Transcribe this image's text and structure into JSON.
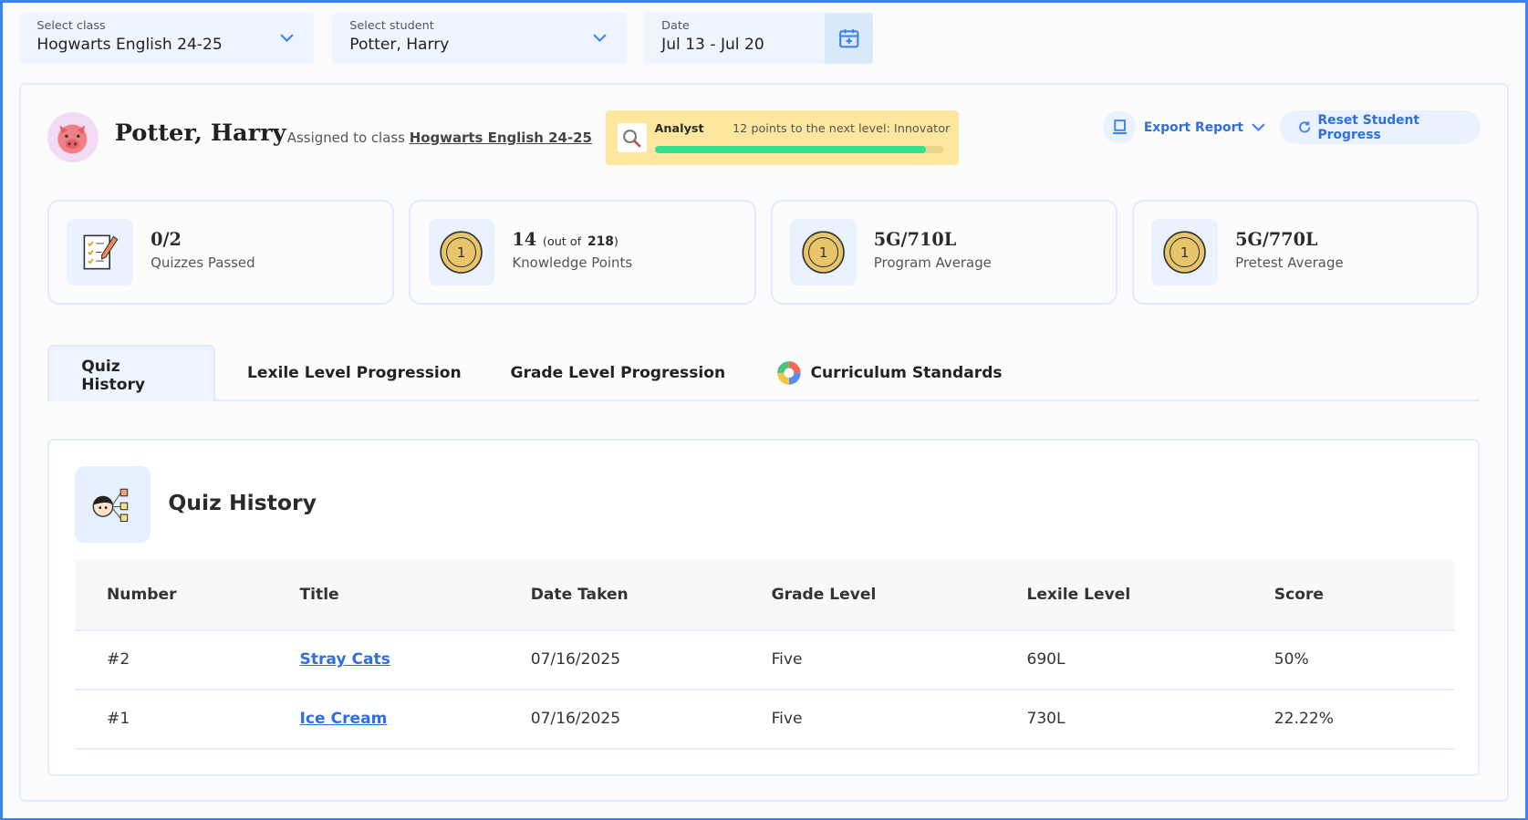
{
  "filters": {
    "class": {
      "label": "Select class",
      "value": "Hogwarts English 24-25"
    },
    "student": {
      "label": "Select student",
      "value": "Potter, Harry"
    },
    "date": {
      "label": "Date",
      "value": "Jul 13 - Jul 20"
    }
  },
  "student": {
    "name": "Potter, Harry",
    "assigned_prefix": "Assigned to class",
    "class_link": "Hogwarts English 24-25"
  },
  "level": {
    "current": "Analyst",
    "next_text": "12 points to the next level: Innovator",
    "progress_percent": 94
  },
  "actions": {
    "export": "Export Report",
    "reset": "Reset Student Progress"
  },
  "stats": [
    {
      "value": "0/2",
      "label": "Quizzes Passed",
      "icon": "quiz-checklist-icon"
    },
    {
      "value": "14",
      "extra_prefix": "(out of",
      "extra_value": "218",
      "extra_suffix": ")",
      "label": "Knowledge Points",
      "icon": "coin-icon"
    },
    {
      "value": "5G/710L",
      "label": "Program Average",
      "icon": "coin-icon"
    },
    {
      "value": "5G/770L",
      "label": "Pretest Average",
      "icon": "coin-icon"
    }
  ],
  "tabs": [
    {
      "label": "Quiz History"
    },
    {
      "label": "Lexile Level Progression"
    },
    {
      "label": "Grade Level Progression"
    },
    {
      "label": "Curriculum Standards"
    }
  ],
  "quiz_history": {
    "title": "Quiz History",
    "columns": [
      "Number",
      "Title",
      "Date Taken",
      "Grade Level",
      "Lexile Level",
      "Score"
    ],
    "rows": [
      [
        "#2",
        "Stray Cats",
        "07/16/2025",
        "Five",
        "690L",
        "50%"
      ],
      [
        "#1",
        "Ice Cream",
        "07/16/2025",
        "Five",
        "730L",
        "22.22%"
      ]
    ]
  }
}
